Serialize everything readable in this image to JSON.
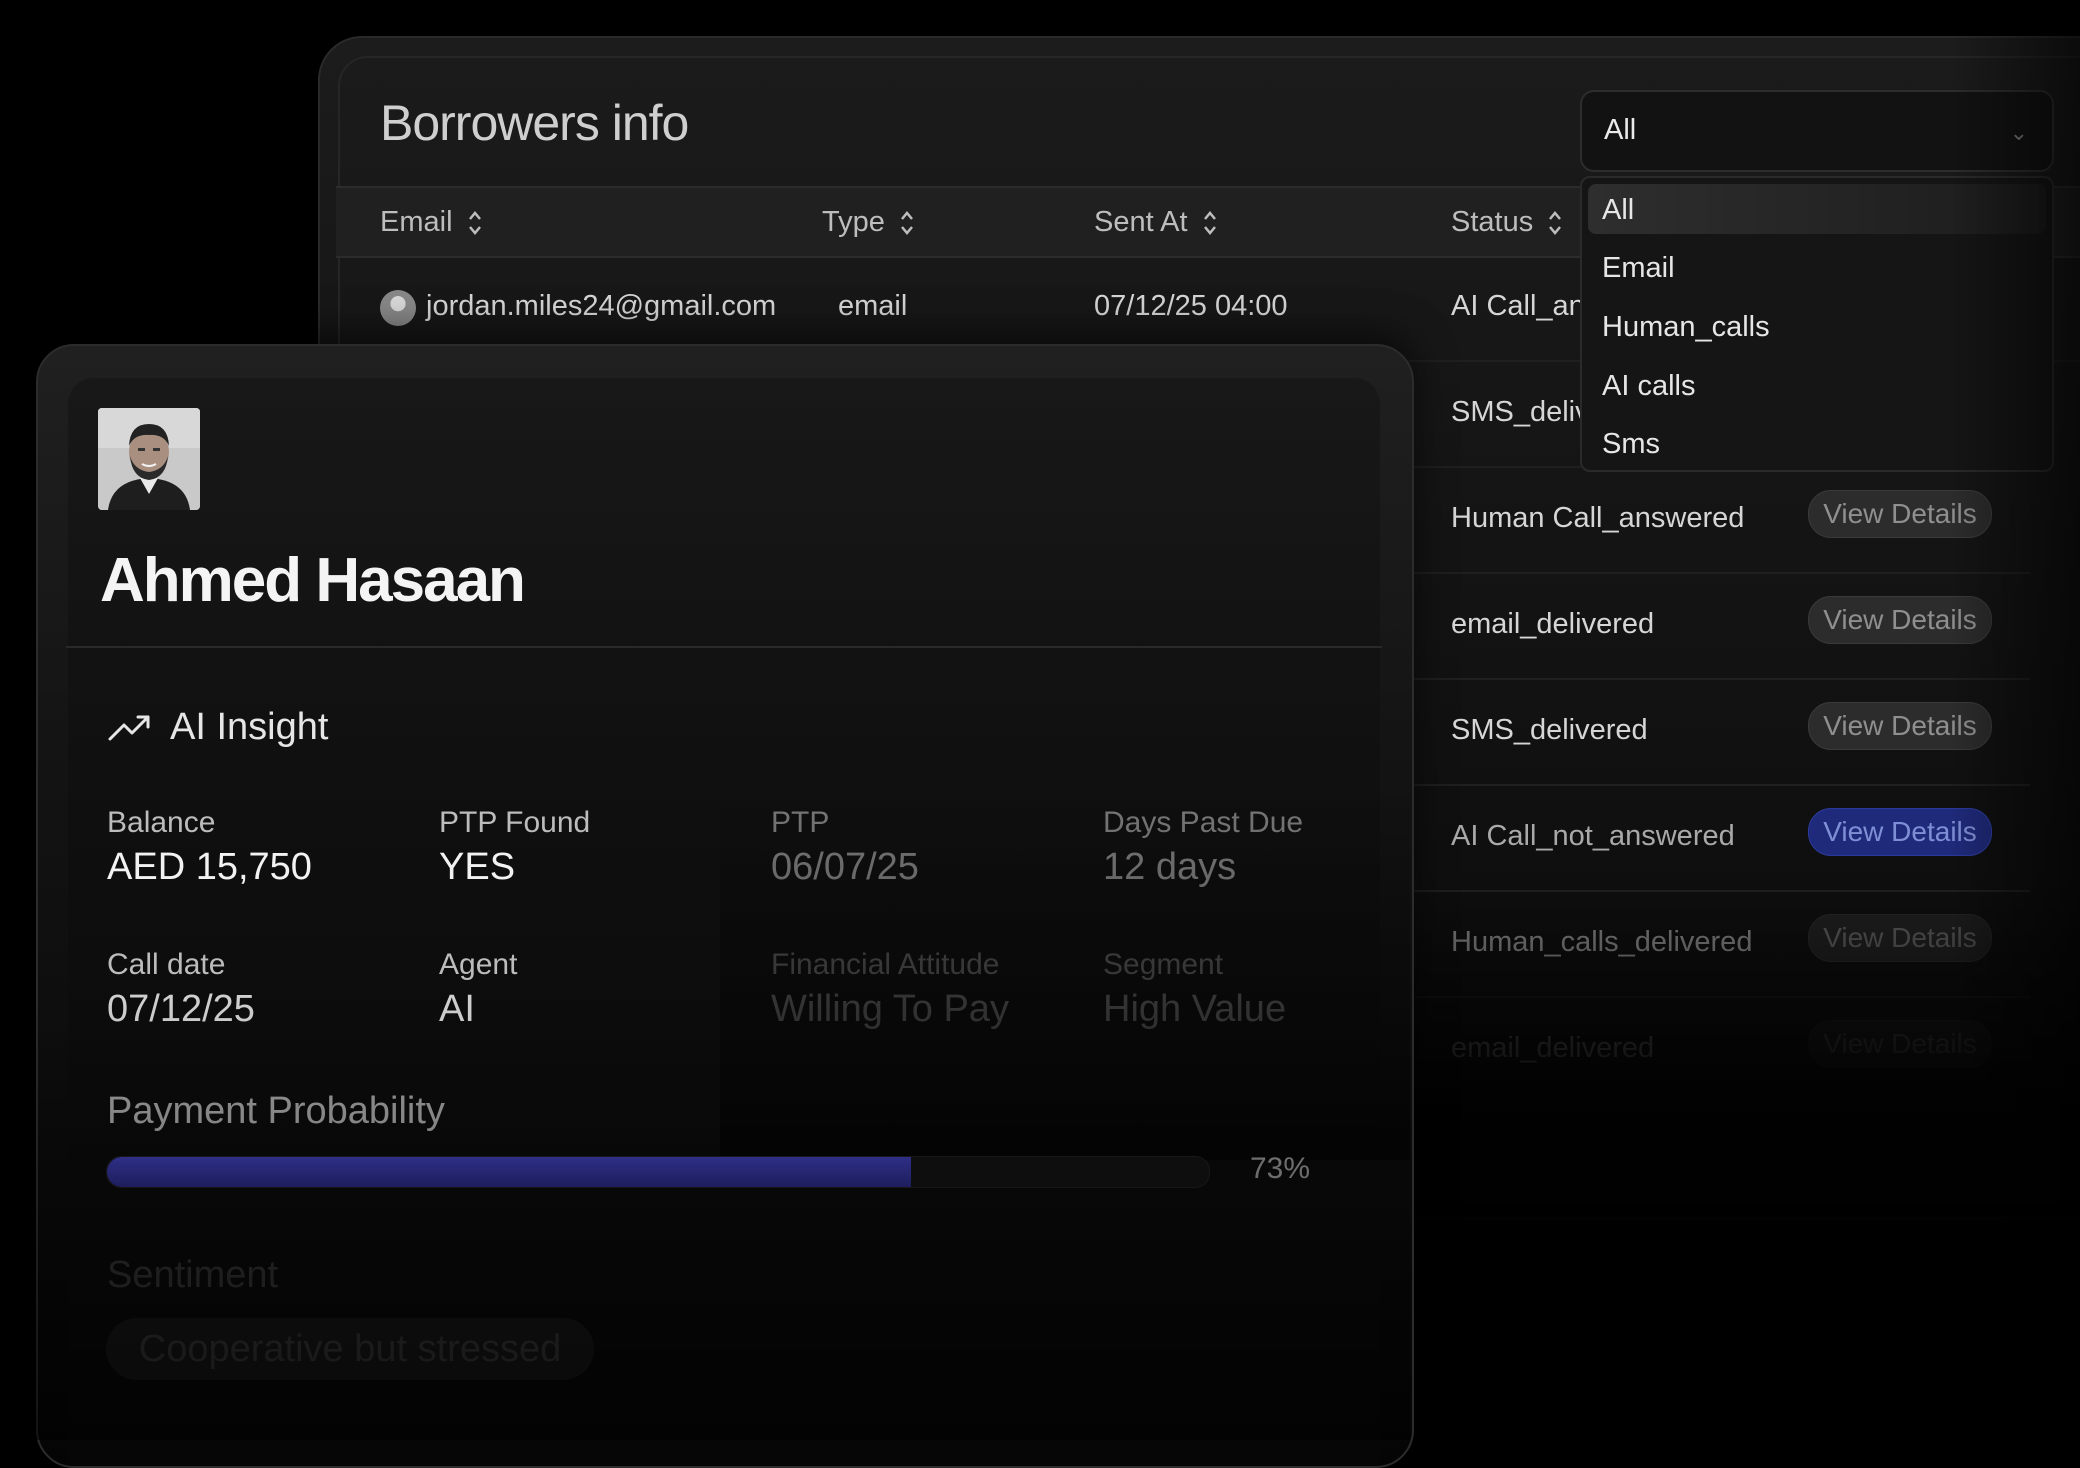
{
  "borrowers": {
    "title": "Borrowers info",
    "columns": [
      "Email",
      "Type",
      "Sent At",
      "Status"
    ],
    "first_row": {
      "email": "jordan.miles24@gmail.com",
      "type": "email",
      "sent_at": "07/12/25 04:00",
      "status": "AI Call_answ"
    },
    "rows": [
      {
        "status": "SMS_delive",
        "action": ""
      },
      {
        "status": "Human Call_answered",
        "action": "View Details"
      },
      {
        "status": "email_delivered",
        "action": "View Details"
      },
      {
        "status": "SMS_delivered",
        "action": "View Details"
      },
      {
        "status": "AI Call_not_answered",
        "action": "View Details"
      },
      {
        "status": "Human_calls_delivered",
        "action": "View Details"
      },
      {
        "status": "email_delivered",
        "action": "View Details"
      }
    ],
    "filter": {
      "value": "All",
      "options": [
        "All",
        "Email",
        "Human_calls",
        "AI calls",
        "Sms"
      ]
    }
  },
  "profile": {
    "name": "Ahmed Hasaan",
    "insight_title": "AI Insight",
    "stats": [
      {
        "label": "Balance",
        "value": "AED 15,750"
      },
      {
        "label": "PTP Found",
        "value": "YES"
      },
      {
        "label": "PTP",
        "value": "06/07/25"
      },
      {
        "label": "Days Past Due",
        "value": "12 days"
      },
      {
        "label": "Call date",
        "value": "07/12/25"
      },
      {
        "label": "Agent",
        "value": "AI"
      },
      {
        "label": "Financial Attitude",
        "value": "Willing To Pay"
      },
      {
        "label": "Segment",
        "value": "High Value"
      }
    ],
    "payment_probability": {
      "label": "Payment Probability",
      "value": 73,
      "display": "73%"
    },
    "sentiment": {
      "label": "Sentiment",
      "value": "Cooperative but stressed"
    }
  },
  "colors": {
    "accent": "#2e2e94",
    "background": "#000000"
  }
}
